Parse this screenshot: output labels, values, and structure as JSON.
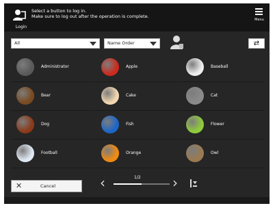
{
  "header": {
    "login_label": "Login",
    "instruction_line1": "Select a button to log in.",
    "instruction_line2": "Make sure to log out after the operation is complete.",
    "menu_label": "Menu"
  },
  "filters": {
    "category": "All",
    "sort": "Name Order"
  },
  "users": [
    {
      "name": "Administrator",
      "icon": "silhouette-icon",
      "color": "#5a5a5a"
    },
    {
      "name": "Apple",
      "icon": "apple-icon",
      "color": "#cc2a1e"
    },
    {
      "name": "Baseball",
      "icon": "baseball-icon",
      "color": "#eeeeee"
    },
    {
      "name": "Bear",
      "icon": "bear-icon",
      "color": "#7a4a20"
    },
    {
      "name": "Cake",
      "icon": "cake-icon",
      "color": "#f2d7b0"
    },
    {
      "name": "Cat",
      "icon": "cat-icon",
      "color": "#8a8a8a"
    },
    {
      "name": "Dog",
      "icon": "dog-icon",
      "color": "#8b3a1a"
    },
    {
      "name": "Fish",
      "icon": "fish-icon",
      "color": "#1c66c8"
    },
    {
      "name": "Flower",
      "icon": "flower-icon",
      "color": "#8fcb3a"
    },
    {
      "name": "Football",
      "icon": "football-icon",
      "color": "#dfe8f2"
    },
    {
      "name": "Orange",
      "icon": "orange-icon",
      "color": "#f08a10"
    },
    {
      "name": "Owl",
      "icon": "owl-icon",
      "color": "#9a7a50"
    }
  ],
  "footer": {
    "cancel_label": "Cancel",
    "page_indicator": "1/2",
    "page_progress": 0.5
  }
}
